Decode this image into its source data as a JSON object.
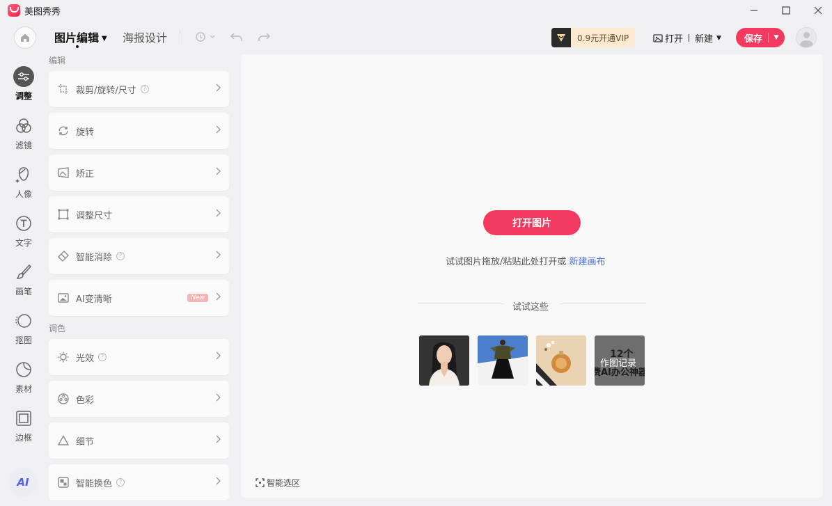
{
  "app": {
    "name": "美图秀秀"
  },
  "toolbar": {
    "tabs": [
      {
        "label": "图片编辑"
      },
      {
        "label": "海报设计"
      }
    ],
    "vip_label": "0.9元开通VIP",
    "open_label": "打开",
    "new_label": "新建",
    "save_label": "保存"
  },
  "rail": {
    "items": [
      {
        "label": "调整",
        "icon": "adjust-icon"
      },
      {
        "label": "滤镜",
        "icon": "filter-icon"
      },
      {
        "label": "人像",
        "icon": "portrait-icon"
      },
      {
        "label": "文字",
        "icon": "text-icon"
      },
      {
        "label": "画笔",
        "icon": "brush-icon"
      },
      {
        "label": "抠图",
        "icon": "cutout-icon"
      },
      {
        "label": "素材",
        "icon": "material-icon"
      },
      {
        "label": "边框",
        "icon": "frame-icon"
      }
    ],
    "ai_label": "AI"
  },
  "panel": {
    "sections": [
      {
        "title": "编辑"
      },
      {
        "title": "调色"
      }
    ],
    "tools": [
      {
        "label": "裁剪/旋转/尺寸",
        "icon": "crop-icon"
      },
      {
        "label": "旋转",
        "icon": "rotate-icon"
      },
      {
        "label": "矫正",
        "icon": "correct-icon"
      },
      {
        "label": "调整尺寸",
        "icon": "resize-icon"
      },
      {
        "label": "智能消除",
        "icon": "eraser-icon"
      },
      {
        "label": "AI变清晰",
        "icon": "enhance-icon",
        "badge": "New"
      },
      {
        "label": "光效",
        "icon": "light-icon"
      },
      {
        "label": "色彩",
        "icon": "color-icon"
      },
      {
        "label": "细节",
        "icon": "detail-icon"
      },
      {
        "label": "智能换色",
        "icon": "recolor-icon"
      }
    ]
  },
  "canvas": {
    "open_button": "打开图片",
    "hint_text": "试试图片拖放/粘贴此处打开或",
    "hint_link": "新建画布",
    "try_label": "试试这些",
    "sample4": {
      "line1": "12个",
      "line2": "作图记录",
      "line3": "费AI办公神器"
    },
    "smart_select": "智能选区"
  },
  "colors": {
    "accent": "#f23a60",
    "link": "#4a6fd6"
  }
}
